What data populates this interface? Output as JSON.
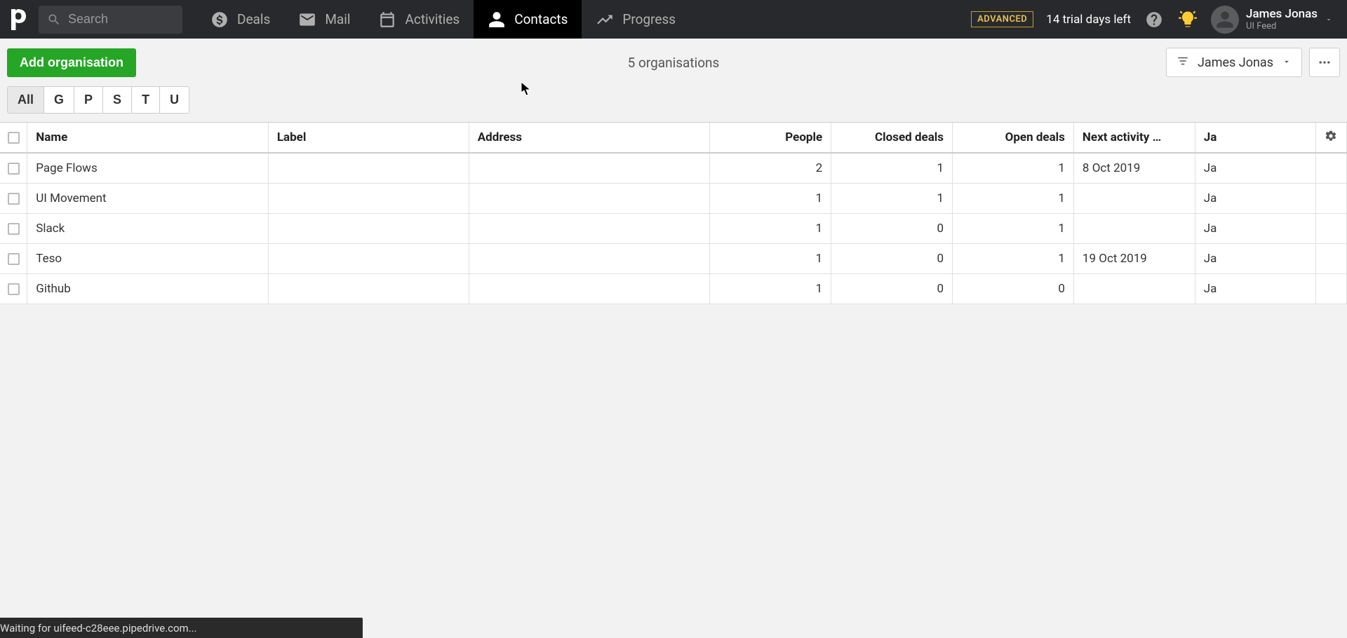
{
  "header": {
    "search_placeholder": "Search",
    "nav": {
      "deals": "Deals",
      "mail": "Mail",
      "activities": "Activities",
      "contacts": "Contacts",
      "progress": "Progress"
    },
    "badge": "ADVANCED",
    "trial": "14 trial days left",
    "user_name": "James Jonas",
    "user_sub": "UI Feed"
  },
  "toolbar": {
    "add_label": "Add organisation",
    "count": "5 organisations",
    "filter_name": "James Jonas"
  },
  "alpha": [
    "All",
    "G",
    "P",
    "S",
    "T",
    "U"
  ],
  "table": {
    "headers": {
      "name": "Name",
      "label": "Label",
      "address": "Address",
      "people": "People",
      "closed": "Closed deals",
      "open": "Open deals",
      "next": "Next activity …",
      "owner_prefix": "Ja"
    },
    "rows": [
      {
        "name": "Page Flows",
        "label": "",
        "address": "",
        "people": "2",
        "closed": "1",
        "open": "1",
        "next": "8 Oct 2019",
        "owner": "Ja"
      },
      {
        "name": "UI Movement",
        "label": "",
        "address": "",
        "people": "1",
        "closed": "1",
        "open": "1",
        "next": "",
        "owner": "Ja"
      },
      {
        "name": "Slack",
        "label": "",
        "address": "",
        "people": "1",
        "closed": "0",
        "open": "1",
        "next": "",
        "owner": "Ja"
      },
      {
        "name": "Teso",
        "label": "",
        "address": "",
        "people": "1",
        "closed": "0",
        "open": "1",
        "next": "19 Oct 2019",
        "owner": "Ja"
      },
      {
        "name": "Github",
        "label": "",
        "address": "",
        "people": "1",
        "closed": "0",
        "open": "0",
        "next": "",
        "owner": "Ja"
      }
    ]
  },
  "status": "Waiting for uifeed-c28eee.pipedrive.com..."
}
